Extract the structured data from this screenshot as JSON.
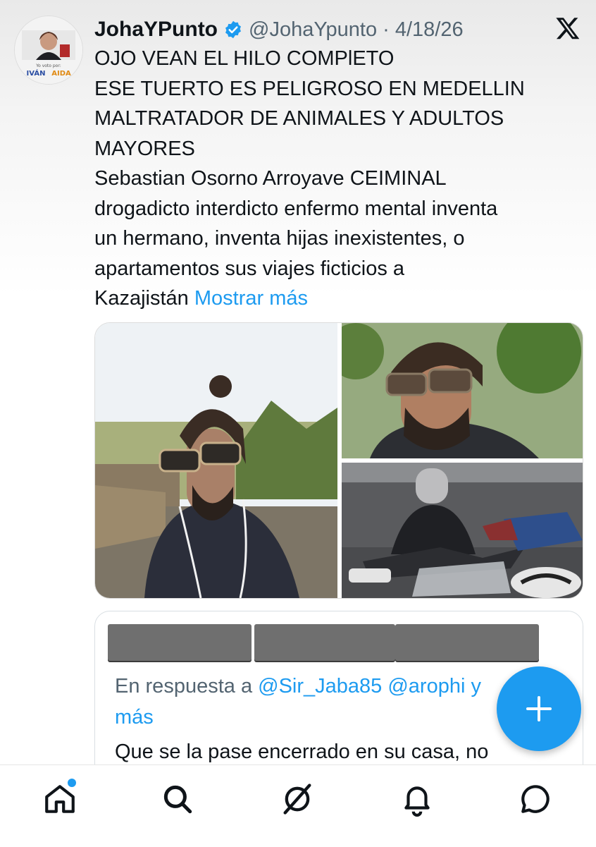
{
  "tweet": {
    "display_name": "JohaYPunto",
    "handle_date": "@JohaYpunto · 4/18/26",
    "text_lines": [
      "OJO VEAN  EL HILO COMPlETO",
      "ESE TUERTO ES PELIGROSO EN MEDELLIN",
      "MALTRATADOR DE ANIMALES Y ADULTOS",
      "MAYORES",
      "Sebastian Osorno Arroyave  CEIMINAL",
      "drogadicto interdicto enfermo mental  inventa",
      "un hermano,  inventa hijas inexistentes, o",
      "apartamentos  sus viajes ficticios a",
      "Kazajistán"
    ],
    "show_more": "Mostrar más",
    "avatar_caption": "Yo voto por:",
    "avatar_text_left": "IVÁN",
    "avatar_text_right": "AIDA"
  },
  "quoted": {
    "reply_prefix": "En respuesta a ",
    "mention_1": "@Sir_Jaba85",
    "mention_2": "@arophi",
    "mention_tail": "y",
    "reply_suffix": "más",
    "text": "Que se la pase encerrado en su casa, no"
  },
  "fab": {
    "label": "+"
  },
  "nav": {
    "items": [
      "home-icon",
      "search-icon",
      "grok-icon",
      "notifications-icon",
      "messages-icon"
    ]
  },
  "colors": {
    "accent": "#1d9bf0",
    "text": "#0f1419",
    "secondary": "#536471"
  }
}
